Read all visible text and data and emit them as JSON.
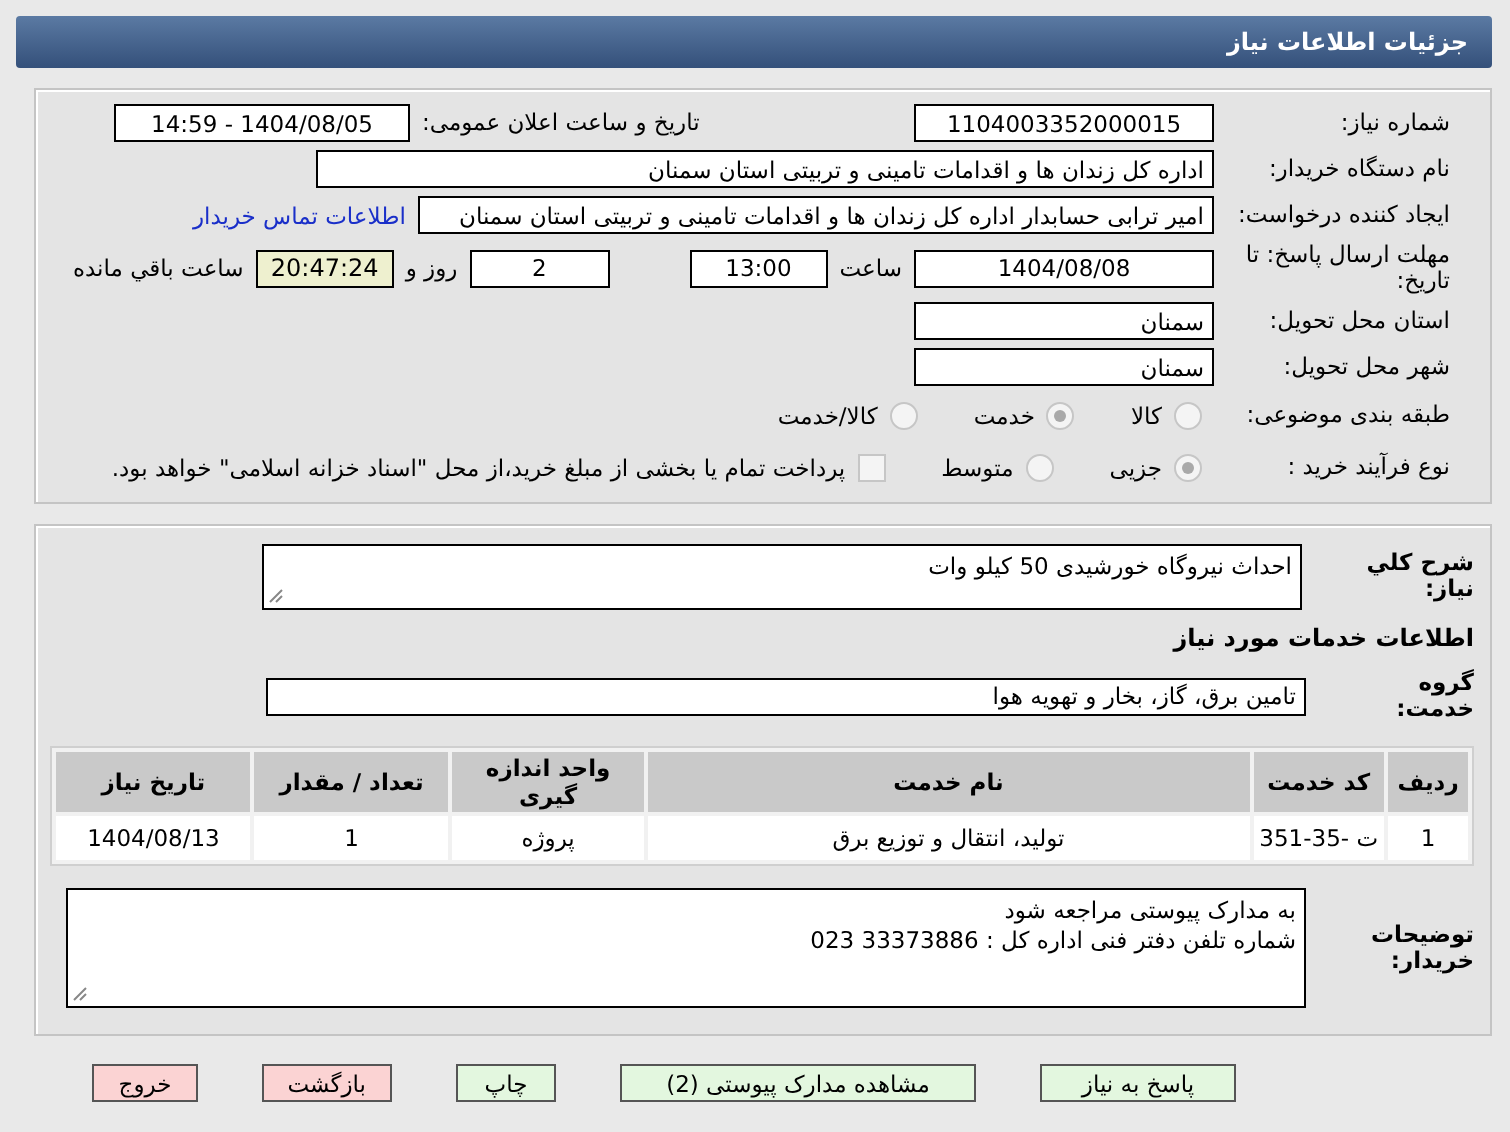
{
  "window": {
    "title": "جزئیات اطلاعات نیاز"
  },
  "need_number": {
    "label": "شماره نیاز:",
    "value": "1104003352000015"
  },
  "announce": {
    "label": "تاریخ و ساعت اعلان عمومی:",
    "value": "1404/08/05 - 14:59"
  },
  "buyer_org": {
    "label": "نام دستگاه خریدار:",
    "value": "اداره کل زندان ها و اقدامات تامینی و تربیتی استان سمنان"
  },
  "requester": {
    "label": "ایجاد کننده درخواست:",
    "value": "امیر ترابی حسابدار اداره کل زندان ها و اقدامات تامینی و تربیتی استان سمنان",
    "link": "اطلاعات تماس خریدار"
  },
  "deadline": {
    "label": "مهلت ارسال پاسخ: تا تاریخ:",
    "date": "1404/08/08",
    "time_label": "ساعت",
    "time": "13:00",
    "days": "2",
    "days_label": "روز و",
    "remaining": "20:47:24",
    "remaining_label": "ساعت باقي مانده"
  },
  "province": {
    "label": "استان محل تحویل:",
    "value": "سمنان"
  },
  "city": {
    "label": "شهر محل تحویل:",
    "value": "سمنان"
  },
  "category": {
    "label": "طبقه بندی موضوعی:",
    "options": [
      {
        "label": "کالا",
        "selected": false
      },
      {
        "label": "خدمت",
        "selected": true
      },
      {
        "label": "کالا/خدمت",
        "selected": false
      }
    ]
  },
  "process": {
    "label": "نوع فرآیند خرید :",
    "options": [
      {
        "label": "جزیی",
        "selected": true
      },
      {
        "label": "متوسط",
        "selected": false
      }
    ],
    "payment": {
      "checked": false,
      "text": "پرداخت تمام یا بخشی از مبلغ خرید،از محل \"اسناد خزانه اسلامی\" خواهد بود."
    }
  },
  "description": {
    "label": "شرح کلي نیاز:",
    "value": "احداث نیروگاه خورشیدی 50 کیلو وات"
  },
  "services_heading": "اطلاعات خدمات مورد نیاز",
  "service_group": {
    "label": "گروه خدمت:",
    "value": "تامین برق، گاز، بخار و تهویه هوا"
  },
  "table": {
    "columns": [
      "ردیف",
      "کد خدمت",
      "نام خدمت",
      "واحد اندازه گیری",
      "تعداد / مقدار",
      "تاریخ نیاز"
    ],
    "rows": [
      [
        "1",
        "ت -35-351",
        "تولید، انتقال و توزیع برق",
        "پروژه",
        "1",
        "1404/08/13"
      ]
    ]
  },
  "buyer_notes": {
    "label": "توضیحات خریدار:",
    "lines": [
      "به مدارک پیوستی مراجعه شود",
      "شماره تلفن دفتر فنی اداره کل : 33373886  023"
    ]
  },
  "buttons": [
    {
      "label": "پاسخ به نیاز",
      "kind": "action"
    },
    {
      "label": "مشاهده مدارک پیوستی (2)",
      "kind": "action"
    },
    {
      "label": "چاپ",
      "kind": "action"
    },
    {
      "label": "بازگشت",
      "kind": "exit"
    },
    {
      "label": "خروج",
      "kind": "exit"
    }
  ]
}
